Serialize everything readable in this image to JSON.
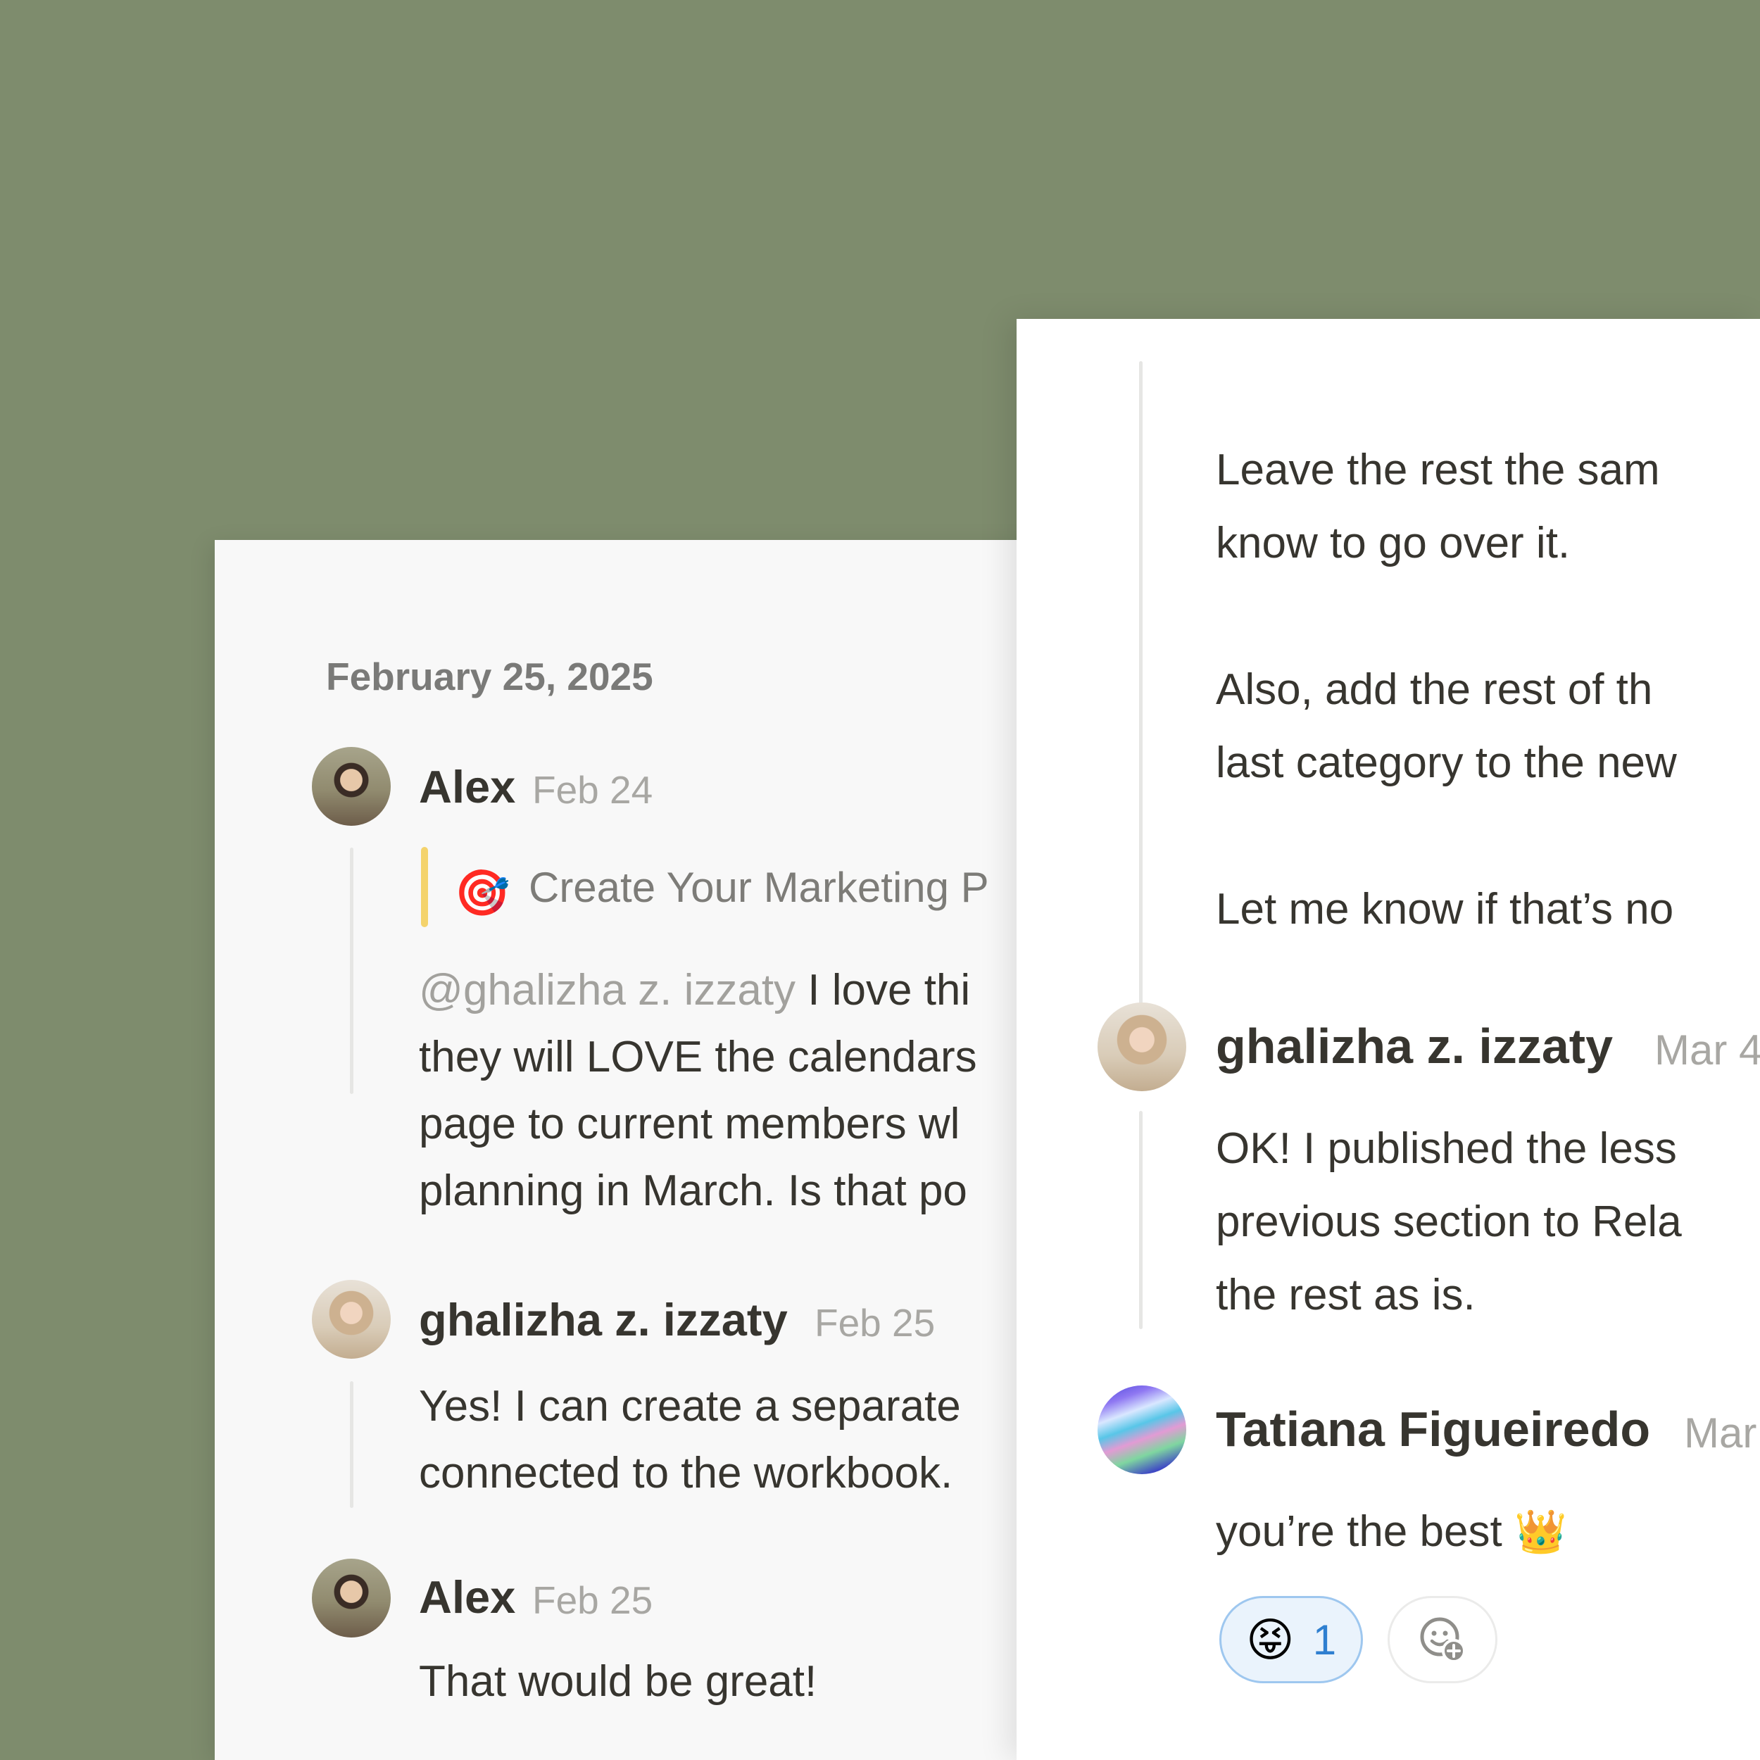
{
  "left_panel": {
    "date_separator": "February 25, 2025",
    "messages": [
      {
        "author": "Alex",
        "time": "Feb 24",
        "quote": {
          "icon": "🎯",
          "text": "Create Your Marketing P"
        },
        "mention": "@ghalizha z. izzaty",
        "lines": [
          " I love thi",
          "they will LOVE the calendars",
          "page to current members wl",
          "planning in March. Is that po"
        ]
      },
      {
        "author": "ghalizha z. izzaty",
        "time": "Feb 25",
        "lines": [
          "Yes! I can create a separate",
          "connected to the workbook."
        ]
      },
      {
        "author": "Alex",
        "time": "Feb 25",
        "lines": [
          "That would be great!"
        ]
      }
    ]
  },
  "right_panel": {
    "paragraphs": [
      [
        "Leave the rest the sam",
        "know to go over it."
      ],
      [
        "Also, add the rest of th",
        "last category to the new"
      ],
      [
        "Let me know if that’s no"
      ]
    ],
    "messages": [
      {
        "author": "ghalizha z. izzaty",
        "time": "Mar 4",
        "lines": [
          "OK! I published the less",
          "previous section to Rela",
          "the rest as is."
        ]
      },
      {
        "author": "Tatiana Figueiredo",
        "time": "Mar",
        "text": "you’re the best",
        "emoji": "👑"
      }
    ],
    "reactions": [
      {
        "emoji": "😝",
        "count": "1"
      }
    ],
    "add_reaction_icon": "add-emoji-icon"
  }
}
